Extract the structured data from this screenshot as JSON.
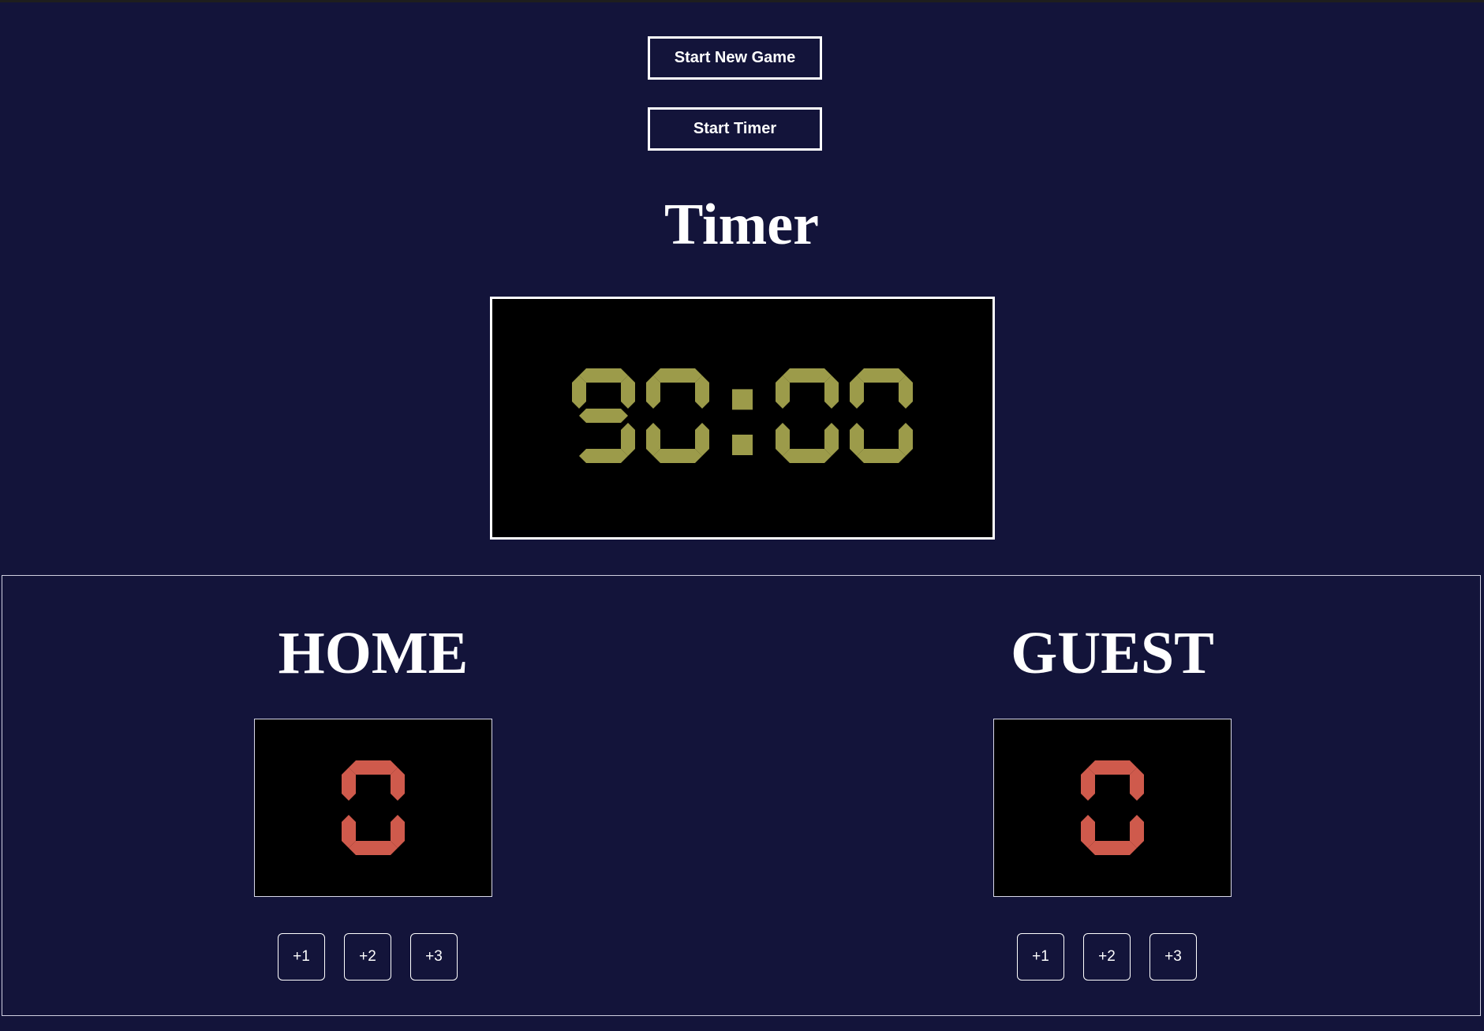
{
  "controls": {
    "new_game_label": "Start New Game",
    "start_timer_label": "Start Timer"
  },
  "timer": {
    "title": "Timer",
    "display": "90:00",
    "digit_color": "#9c9b4a"
  },
  "home": {
    "name": "HOME",
    "score": "0",
    "buttons": [
      "+1",
      "+2",
      "+3"
    ]
  },
  "guest": {
    "name": "GUEST",
    "score": "0",
    "buttons": [
      "+1",
      "+2",
      "+3"
    ]
  },
  "score_digit_color": "#cf5a4c",
  "colors": {
    "background": "#13143a",
    "panel": "#000000",
    "border": "#ffffff"
  }
}
